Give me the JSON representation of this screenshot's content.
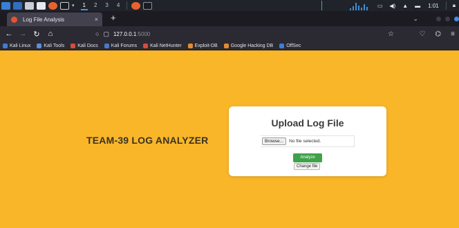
{
  "taskbar": {
    "workspaces": [
      "1",
      "2",
      "3",
      "4"
    ],
    "active_workspace": "1",
    "clock": "1:01"
  },
  "browser": {
    "tab_title": "Log File Analysis",
    "tab_close": "×",
    "new_tab": "+",
    "url_host": "127.0.0.1",
    "url_port": ":5000",
    "bookmarks": [
      {
        "label": "Kali Linux",
        "color": "#3a7fd5"
      },
      {
        "label": "Kali Tools",
        "color": "#5b8fd8"
      },
      {
        "label": "Kali Docs",
        "color": "#d94b3a"
      },
      {
        "label": "Kali Forums",
        "color": "#4a78c9"
      },
      {
        "label": "Kali NetHunter",
        "color": "#d94b3a"
      },
      {
        "label": "Exploit-DB",
        "color": "#e58a2e"
      },
      {
        "label": "Google Hacking DB",
        "color": "#e58a2e"
      },
      {
        "label": "OffSec",
        "color": "#3a7fd5"
      }
    ]
  },
  "page": {
    "app_title": "TEAM-39 LOG ANALYZER",
    "upload": {
      "heading": "Upload Log File",
      "browse_label": "Browse...",
      "file_status": "No file selected.",
      "analyze_label": "Analyze",
      "change_label": "Change file"
    }
  },
  "colors": {
    "page_background": "#f9b629",
    "analyze_button": "#3fa24a",
    "browser_chrome": "#2b2a33"
  }
}
